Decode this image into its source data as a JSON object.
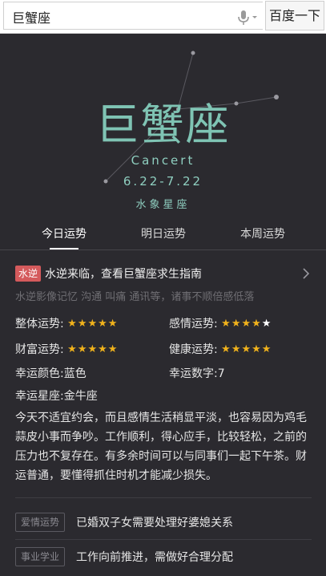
{
  "search": {
    "query": "巨蟹座",
    "button_label": "百度一下",
    "mic_icon": "microphone-icon"
  },
  "hero": {
    "zh_name": "巨蟹座",
    "en_name": "Cancert",
    "date_range": "6.22-7.22",
    "element": "水象星座"
  },
  "tabs": [
    {
      "label": "今日运势",
      "active": true
    },
    {
      "label": "明日运势",
      "active": false
    },
    {
      "label": "本周运势",
      "active": false
    }
  ],
  "notice": {
    "badge": "水逆",
    "title": "水逆来临，查看巨蟹座求生指南",
    "subtitle": "水逆影像记忆 沟通 叫痛 通讯等，诸事不顺倍感低落"
  },
  "fortune": {
    "overall_label": "整体运势:",
    "overall_rating": 5,
    "love_label": "感情运势:",
    "love_rating": 4,
    "wealth_label": "财富运势:",
    "wealth_rating": 5,
    "health_label": "健康运势:",
    "health_rating": 5,
    "lucky_color": "幸运颜色:蓝色",
    "lucky_number": "幸运数字:7",
    "lucky_sign": "幸运星座:金牛座"
  },
  "description": "今天不适宜约会，而且感情生活稍显平淡，也容易因为鸡毛蒜皮小事而争吵。工作顺利，得心应手，比较轻松，之前的压力也不复存在。有多余时间可以与同事们一起下午茶。财运普通，要懂得抓住时机才能减少损失。",
  "extras": [
    {
      "tag": "爱情运势",
      "text": "已婚双子女需要处理好婆媳关系"
    },
    {
      "tag": "事业学业",
      "text": "工作向前推进，需做好合理分配"
    }
  ],
  "colors": {
    "background": "#2b2a2f",
    "accent_teal": "#7fc4b4",
    "star_gold": "#f0b21c",
    "badge_red": "#d45a5c"
  }
}
